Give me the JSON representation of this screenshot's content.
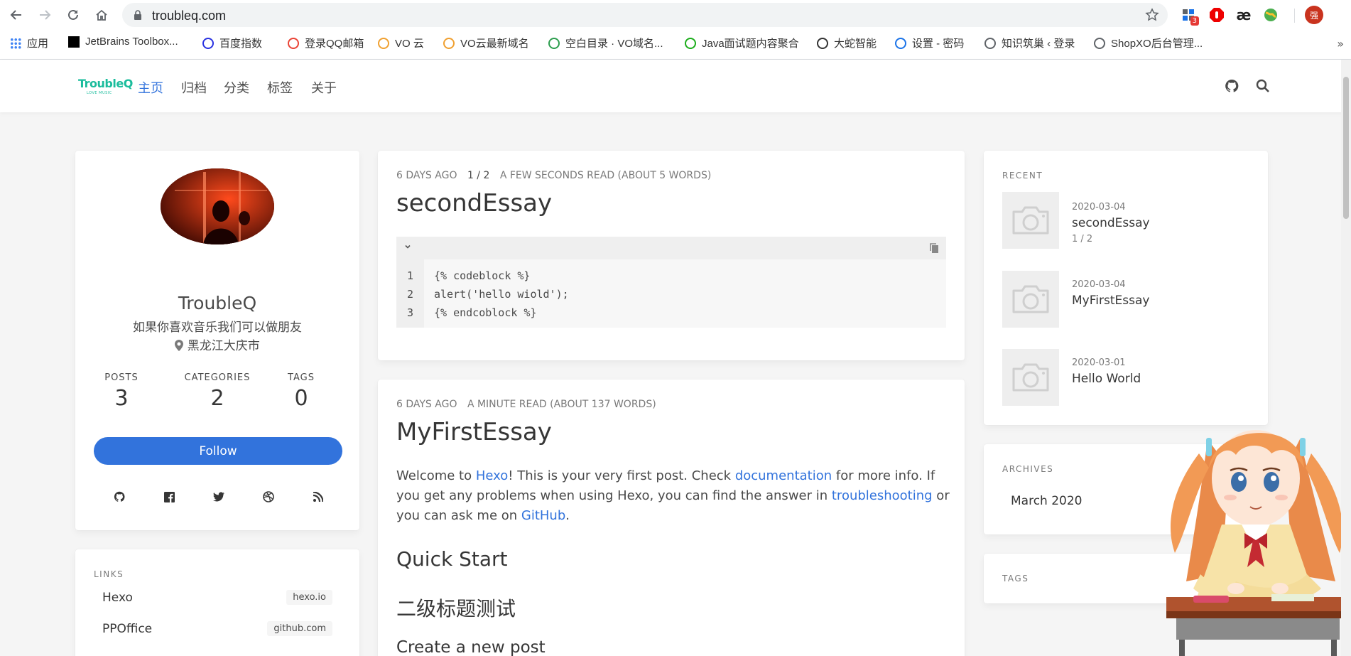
{
  "browser": {
    "url": "troubleq.com",
    "extension_badge": "3",
    "extension_ae": "æ",
    "profile_initial": "强",
    "bookmarks": [
      {
        "label": "应用",
        "icon": "apps-grid-icon",
        "color": "#4285f4"
      },
      {
        "label": "JetBrains Toolbox...",
        "icon": "jetbrains-icon",
        "color": "#000000"
      },
      {
        "label": "百度指数",
        "icon": "baidu-paw-icon",
        "color": "#2932e1"
      },
      {
        "label": "登录QQ邮箱",
        "icon": "qq-mail-icon",
        "color": "#ea4335"
      },
      {
        "label": "VO 云",
        "icon": "globe-orange-icon",
        "color": "#f0a030"
      },
      {
        "label": "VO云最新域名",
        "icon": "globe-orange-icon",
        "color": "#f0a030"
      },
      {
        "label": "空白目录 · VO域名...",
        "icon": "leaf-icon",
        "color": "#2e9e4f"
      },
      {
        "label": "Java面试题内容聚合",
        "icon": "wechat-icon",
        "color": "#1aad19"
      },
      {
        "label": "大蛇智能",
        "icon": "snake-icon",
        "color": "#333333"
      },
      {
        "label": "设置 - 密码",
        "icon": "settings-gear-icon",
        "color": "#1a73e8"
      },
      {
        "label": "知识筑巢 ‹ 登录",
        "icon": "globe-gray-icon",
        "color": "#5f6368"
      },
      {
        "label": "ShopXO后台管理...",
        "icon": "globe-gray-icon",
        "color": "#5f6368"
      }
    ],
    "bookmarks_more": "»"
  },
  "site": {
    "logo": "TroubleQ",
    "logo_sub": "LOVE MUSIC",
    "nav": [
      {
        "label": "主页",
        "active": true
      },
      {
        "label": "归档",
        "active": false
      },
      {
        "label": "分类",
        "active": false
      },
      {
        "label": "标签",
        "active": false
      },
      {
        "label": "关于",
        "active": false
      }
    ]
  },
  "profile": {
    "name": "TroubleQ",
    "bio": "如果你喜欢音乐我们可以做朋友",
    "location": "黑龙江大庆市",
    "stats": [
      {
        "label": "POSTS",
        "value": "3"
      },
      {
        "label": "CATEGORIES",
        "value": "2"
      },
      {
        "label": "TAGS",
        "value": "0"
      }
    ],
    "follow_label": "Follow",
    "social_icons": [
      "github-icon",
      "facebook-icon",
      "twitter-icon",
      "dribbble-icon",
      "rss-icon"
    ]
  },
  "links": {
    "title": "LINKS",
    "items": [
      {
        "name": "Hexo",
        "tag": "hexo.io"
      },
      {
        "name": "PPOffice",
        "tag": "github.com"
      }
    ]
  },
  "posts": [
    {
      "date": "6 DAYS AGO",
      "category": "1 / 2",
      "read": "A FEW SECONDS READ (ABOUT 5 WORDS)",
      "title": "secondEssay",
      "code_lines": [
        "{% codeblock %}",
        "alert('hello wiold');",
        "{% endcoblock %}"
      ],
      "line_numbers": [
        "1",
        "2",
        "3"
      ]
    },
    {
      "date": "6 DAYS AGO",
      "read": "A MINUTE READ (ABOUT 137 WORDS)",
      "title": "MyFirstEssay",
      "body": {
        "t1": "Welcome to ",
        "l1": "Hexo",
        "t2": "! This is your very first post. Check ",
        "l2": "documentation",
        "t3": " for more info. If you get any problems when using Hexo, you can find the answer in ",
        "l3": "troubleshooting",
        "t4": " or you can ask me on ",
        "l4": "GitHub",
        "t5": "."
      },
      "h2_1": "Quick Start",
      "h2_2": "二级标题测试",
      "h3": "Create a new post"
    }
  ],
  "recent": {
    "title": "RECENT",
    "items": [
      {
        "date": "2020-03-04",
        "title": "secondEssay",
        "category": "1 / 2"
      },
      {
        "date": "2020-03-04",
        "title": "MyFirstEssay",
        "category": ""
      },
      {
        "date": "2020-03-01",
        "title": "Hello World",
        "category": ""
      }
    ]
  },
  "archives": {
    "title": "ARCHIVES",
    "items": [
      "March 2020"
    ]
  },
  "tags": {
    "title": "TAGS"
  },
  "colors": {
    "accent": "#3273dc",
    "logo": "#1abc9c",
    "background": "#f5f5f5"
  }
}
